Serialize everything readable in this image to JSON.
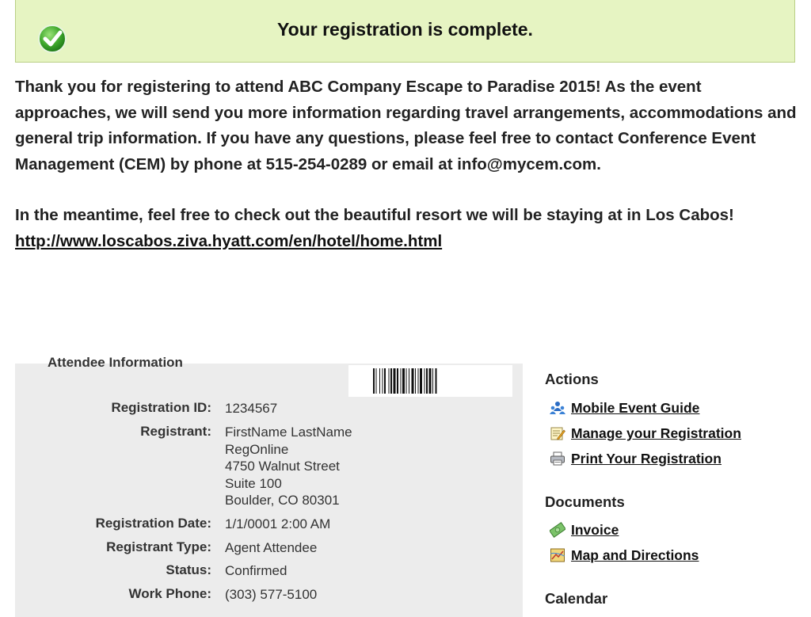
{
  "banner": {
    "title": "Your registration is complete."
  },
  "message": {
    "paragraph1": "Thank you for registering to attend ABC Company Escape to Paradise 2015! As the event approaches, we will send you more information regarding travel arrangements, accommodations and general trip information. If you have any questions, please feel free to contact Conference Event Management (CEM) by phone at 515-254-0289 or email at info@mycem.com.",
    "paragraph2": "In the meantime, feel free to check out the beautiful resort we will be staying at in Los Cabos!",
    "link": "http://www.loscabos.ziva.hyatt.com/en/hotel/home.html"
  },
  "attendee": {
    "legend": "Attendee Information",
    "registration_id_label": "Registration ID:",
    "registration_id": "1234567",
    "registrant_label": "Registrant:",
    "registrant_lines": [
      "FirstName LastName",
      "RegOnline",
      "4750 Walnut Street",
      "Suite 100",
      "Boulder, CO 80301"
    ],
    "registration_date_label": "Registration Date:",
    "registration_date": "1/1/0001 2:00 AM",
    "registrant_type_label": "Registrant Type:",
    "registrant_type": "Agent Attendee",
    "status_label": "Status:",
    "status": "Confirmed",
    "work_phone_label": "Work Phone:",
    "work_phone": "(303) 577-5100"
  },
  "sidebar": {
    "actions_heading": "Actions",
    "actions": [
      {
        "label": "Mobile Event Guide",
        "icon": "people-icon"
      },
      {
        "label": "Manage your Registration",
        "icon": "edit-notepad-icon"
      },
      {
        "label": "Print Your Registration",
        "icon": "printer-icon"
      }
    ],
    "documents_heading": "Documents",
    "documents": [
      {
        "label": "Invoice",
        "icon": "money-icon"
      },
      {
        "label": "Map and Directions",
        "icon": "map-icon"
      }
    ],
    "calendar_heading": "Calendar"
  },
  "colors": {
    "banner_bg": "#e6f4c2",
    "banner_border": "#b9cf86",
    "panel_bg": "#ececec"
  }
}
